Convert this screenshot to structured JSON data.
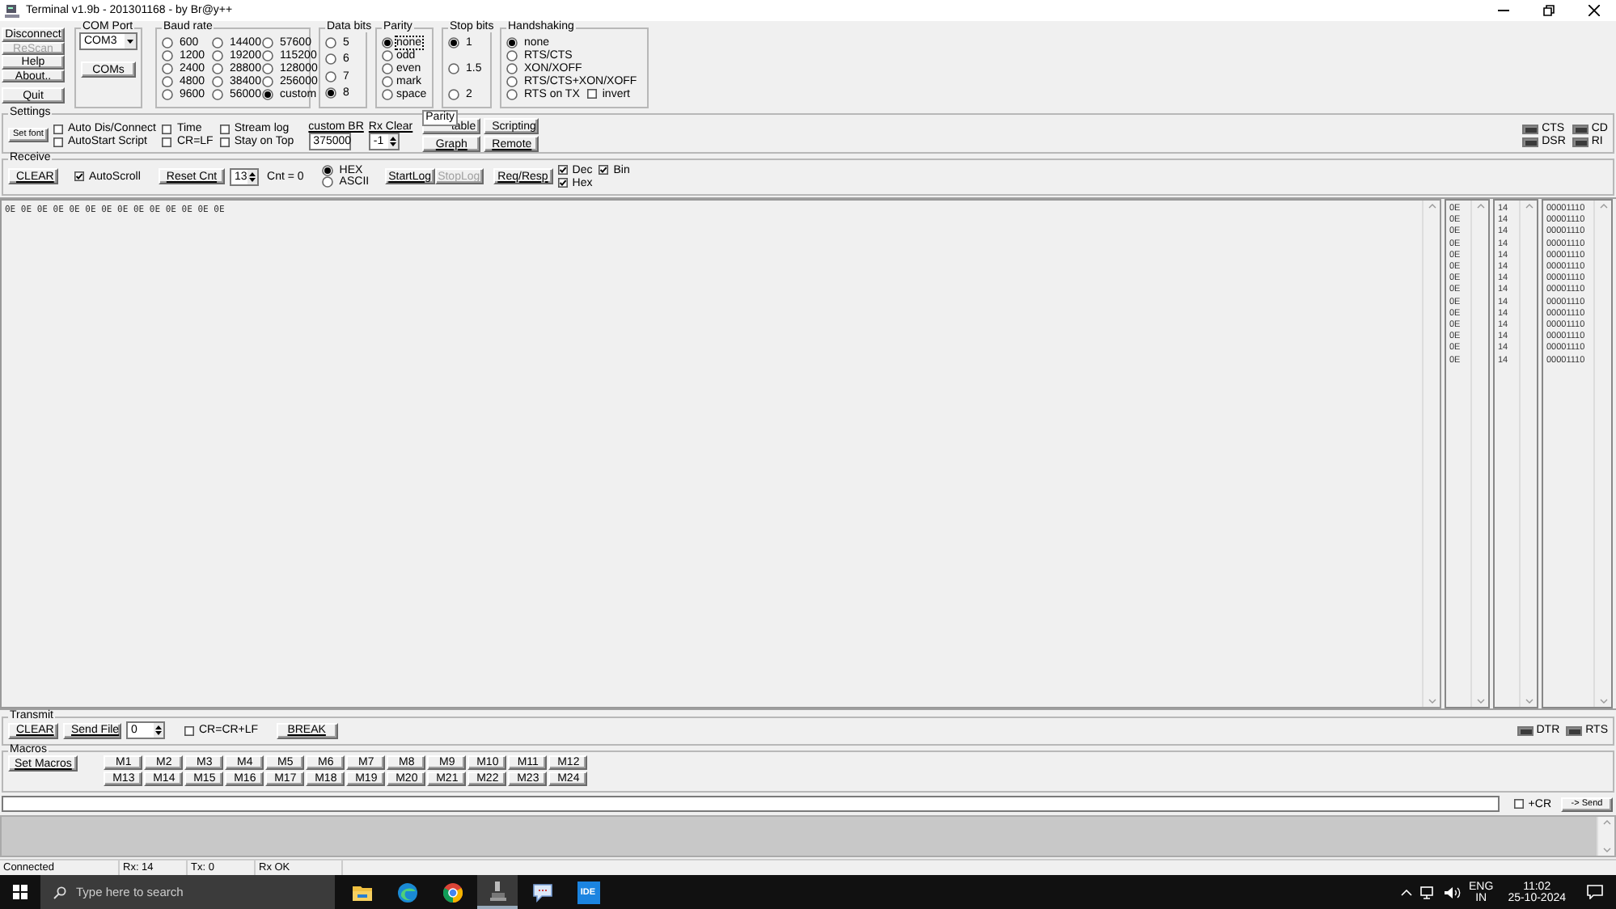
{
  "window": {
    "title": "Terminal v1.9b - 201301168 - by Br@y++"
  },
  "connection_buttons": [
    {
      "label": "Disconnect",
      "disabled": false
    },
    {
      "label": "ReScan",
      "disabled": true
    },
    {
      "label": "Help",
      "disabled": false
    },
    {
      "label": "About..",
      "disabled": false
    },
    {
      "label": "Quit",
      "disabled": false
    }
  ],
  "com_port": {
    "label": "COM Port",
    "value": "COM3",
    "button": "COMs"
  },
  "baud_rate": {
    "label": "Baud rate",
    "options": [
      {
        "label": "600",
        "selected": false
      },
      {
        "label": "1200",
        "selected": false
      },
      {
        "label": "2400",
        "selected": false
      },
      {
        "label": "4800",
        "selected": false
      },
      {
        "label": "9600",
        "selected": false
      },
      {
        "label": "14400",
        "selected": false
      },
      {
        "label": "19200",
        "selected": false
      },
      {
        "label": "28800",
        "selected": false
      },
      {
        "label": "38400",
        "selected": false
      },
      {
        "label": "56000",
        "selected": false
      },
      {
        "label": "57600",
        "selected": false
      },
      {
        "label": "115200",
        "selected": false
      },
      {
        "label": "128000",
        "selected": false
      },
      {
        "label": "256000",
        "selected": false
      },
      {
        "label": "custom",
        "selected": true
      }
    ]
  },
  "data_bits": {
    "label": "Data bits",
    "options": [
      {
        "label": "5",
        "selected": false
      },
      {
        "label": "6",
        "selected": false
      },
      {
        "label": "7",
        "selected": false
      },
      {
        "label": "8",
        "selected": true
      }
    ]
  },
  "parity": {
    "label": "Parity",
    "options": [
      {
        "label": "none",
        "selected": true
      },
      {
        "label": "odd",
        "selected": false
      },
      {
        "label": "even",
        "selected": false
      },
      {
        "label": "mark",
        "selected": false
      },
      {
        "label": "space",
        "selected": false
      }
    ]
  },
  "stop_bits": {
    "label": "Stop bits",
    "options": [
      {
        "label": "1",
        "selected": true
      },
      {
        "label": "1.5",
        "selected": false
      },
      {
        "label": "2",
        "selected": false
      }
    ]
  },
  "handshaking": {
    "label": "Handshaking",
    "options": [
      {
        "label": "none",
        "selected": true
      },
      {
        "label": "RTS/CTS",
        "selected": false
      },
      {
        "label": "XON/XOFF",
        "selected": false
      },
      {
        "label": "RTS/CTS+XON/XOFF",
        "selected": false
      },
      {
        "label": "RTS on TX",
        "selected": false
      }
    ],
    "invert": {
      "label": "invert",
      "checked": false
    }
  },
  "settings": {
    "label": "Settings",
    "set_font": "Set font",
    "checkboxes": [
      {
        "label": "Auto Dis/Connect",
        "checked": false
      },
      {
        "label": "AutoStart Script",
        "checked": false
      },
      {
        "label": "Time",
        "checked": false
      },
      {
        "label": "CR=LF",
        "checked": false
      },
      {
        "label": "Stream log",
        "checked": false
      },
      {
        "label": "Stay on Top",
        "checked": false
      }
    ],
    "custom_br": {
      "label": "custom BR",
      "value": "375000"
    },
    "rx_clear": {
      "label": "Rx Clear",
      "value": "-1"
    },
    "buttons": [
      "table",
      "Scripting",
      "Graph",
      "Remote"
    ],
    "tooltip": "Parity",
    "lights": [
      "CTS",
      "CD",
      "DSR",
      "RI"
    ]
  },
  "receive": {
    "label": "Receive",
    "clear": "CLEAR",
    "autoscroll": {
      "label": "AutoScroll",
      "checked": true
    },
    "reset_cnt": "Reset Cnt",
    "spin": "13",
    "count": "Cnt = 0",
    "modes": [
      {
        "label": "HEX",
        "selected": true
      },
      {
        "label": "ASCII",
        "selected": false
      }
    ],
    "start_log": "StartLog",
    "stop_log": {
      "label": "StopLog",
      "disabled": true
    },
    "req_resp": "Req/Resp",
    "views": [
      {
        "label": "Dec",
        "checked": true
      },
      {
        "label": "Bin",
        "checked": true
      },
      {
        "label": "Hex",
        "checked": true
      }
    ]
  },
  "rx_text": "0E 0E 0E 0E 0E 0E 0E 0E 0E 0E 0E 0E 0E 0E",
  "rx_columns": [
    {
      "values": [
        "0E",
        "0E",
        "0E",
        "0E",
        "0E",
        "0E",
        "0E",
        "0E",
        "0E",
        "0E",
        "0E",
        "0E",
        "0E",
        "0E"
      ]
    },
    {
      "values": [
        "14",
        "14",
        "14",
        "14",
        "14",
        "14",
        "14",
        "14",
        "14",
        "14",
        "14",
        "14",
        "14",
        "14"
      ]
    },
    {
      "values": [
        "00001110",
        "00001110",
        "00001110",
        "00001110",
        "00001110",
        "00001110",
        "00001110",
        "00001110",
        "00001110",
        "00001110",
        "00001110",
        "00001110",
        "00001110",
        "00001110"
      ]
    }
  ],
  "transmit": {
    "label": "Transmit",
    "clear": "CLEAR",
    "send_file": "Send File",
    "spin": "0",
    "cr": {
      "label": "CR=CR+LF",
      "checked": false
    },
    "break": "BREAK",
    "lights": [
      "DTR",
      "RTS"
    ]
  },
  "macros": {
    "label": "Macros",
    "set_macros": "Set Macros",
    "buttons": [
      "M1",
      "M2",
      "M3",
      "M4",
      "M5",
      "M6",
      "M7",
      "M8",
      "M9",
      "M10",
      "M11",
      "M12",
      "M13",
      "M14",
      "M15",
      "M16",
      "M17",
      "M18",
      "M19",
      "M20",
      "M21",
      "M22",
      "M23",
      "M24"
    ]
  },
  "send_line": {
    "plus_cr": {
      "label": "+CR",
      "checked": false
    },
    "send": "-> Send"
  },
  "status_bar": [
    "Connected",
    "Rx: 14",
    "Tx: 0",
    "Rx OK"
  ],
  "taskbar": {
    "search_placeholder": "Type here to search",
    "ide_label": "IDE",
    "language": "ENG",
    "region": "IN",
    "time": "11:02",
    "date": "25-10-2024"
  }
}
